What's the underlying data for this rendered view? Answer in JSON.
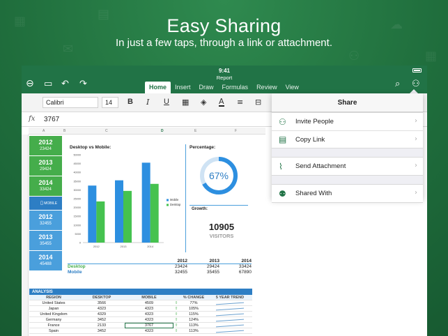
{
  "hero": {
    "title": "Easy Sharing",
    "subtitle": "In just a few taps, through a link or attachment."
  },
  "status": {
    "time": "9:41",
    "document": "Report"
  },
  "toolbar": {
    "icons": [
      "back-icon",
      "file-icon",
      "undo-icon",
      "redo-icon",
      "search-icon",
      "share-person-icon"
    ],
    "tabs": [
      {
        "label": "Home",
        "active": true
      },
      {
        "label": "Insert"
      },
      {
        "label": "Draw"
      },
      {
        "label": "Formulas"
      },
      {
        "label": "Review"
      },
      {
        "label": "View"
      }
    ]
  },
  "ribbon": {
    "font": "Calibri",
    "size": "14",
    "bold": "B",
    "italic": "I",
    "underline": "U"
  },
  "formula": {
    "fx": "fx",
    "value": "3767"
  },
  "columns": [
    "A",
    "B",
    "C",
    "D",
    "E",
    "F",
    "G"
  ],
  "years": [
    {
      "year": "2012",
      "value": "23424",
      "color": "green"
    },
    {
      "year": "2013",
      "value": "29424",
      "color": "green"
    },
    {
      "year": "2014",
      "value": "33424",
      "color": "green"
    },
    {
      "year": "MOBILE",
      "value": "",
      "color": "mobile"
    },
    {
      "year": "2012",
      "value": "32455",
      "color": "blue"
    },
    {
      "year": "2013",
      "value": "35455",
      "color": "blue"
    },
    {
      "year": "2014",
      "value": "45488",
      "color": "blue"
    }
  ],
  "sheet": {
    "chart_title": "Desktop vs Mobile:",
    "percentage_label": "Percentage:",
    "percentage_value": "67%",
    "growth_label": "Growth:",
    "visitors_num": "10905",
    "visitors_lbl": "VISITORS",
    "summary_years": [
      "2012",
      "2013",
      "2014"
    ],
    "summary_rows": [
      {
        "label": "Desktop",
        "values": [
          "23424",
          "29424",
          "33424"
        ]
      },
      {
        "label": "Mobile",
        "values": [
          "32455",
          "35455",
          "67890"
        ]
      }
    ],
    "analysis_title": "ANALYSIS",
    "analysis_headers": [
      "REGION",
      "DESKTOP",
      "MOBILE",
      "",
      "% CHANGE",
      "5 YEAR TREND"
    ],
    "analysis_rows": [
      [
        "United States",
        "3566",
        "4509",
        "77%"
      ],
      [
        "Japan",
        "4323",
        "4323",
        "105%"
      ],
      [
        "United Kingdom",
        "4329",
        "4323",
        "115%"
      ],
      [
        "Germany",
        "3452",
        "4323",
        "124%"
      ],
      [
        "France",
        "2133",
        "3767",
        "113%"
      ],
      [
        "Spain",
        "3452",
        "4323",
        "113%"
      ]
    ],
    "row_numbers": [
      "40",
      "41",
      "42",
      "43",
      "44",
      "45",
      "46",
      "47",
      "48"
    ]
  },
  "chart_data": {
    "type": "bar",
    "title": "Desktop vs Mobile:",
    "categories": [
      "2012",
      "2013",
      "2014"
    ],
    "series": [
      {
        "name": "Mobile",
        "color": "#2d8fe0",
        "values": [
          32455,
          35455,
          45488
        ]
      },
      {
        "name": "Desktop",
        "color": "#45c24f",
        "values": [
          23424,
          29424,
          33424
        ]
      }
    ],
    "ylim": [
      0,
      50000
    ],
    "yticks": [
      "0",
      "5000",
      "10000",
      "15000",
      "20000",
      "25000",
      "30000",
      "35000",
      "40000",
      "45000",
      "50000"
    ],
    "legend": "right"
  },
  "share": {
    "title": "Share",
    "items": [
      {
        "label": "Invite People",
        "icon": "add-person-icon",
        "glyph": "⚇"
      },
      {
        "label": "Copy Link",
        "icon": "clipboard-icon",
        "glyph": "▤"
      },
      {
        "label": "Send Attachment",
        "icon": "paperclip-icon",
        "glyph": "⌇"
      },
      {
        "label": "Shared With",
        "icon": "people-icon",
        "glyph": "⚉"
      }
    ]
  }
}
